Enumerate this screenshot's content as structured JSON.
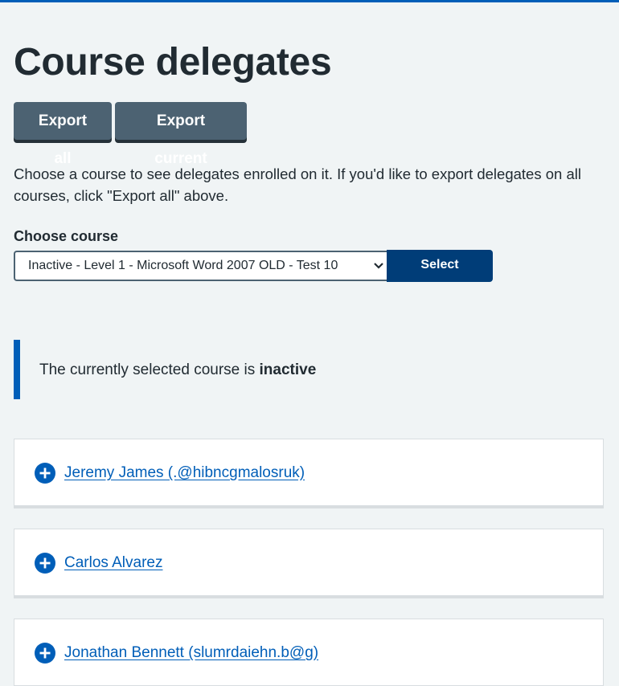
{
  "page": {
    "title": "Course delegates",
    "intro": "Choose a course to see delegates enrolled on it. If you'd like to export delegates on all courses, click \"Export all\" above."
  },
  "toolbar": {
    "export_all_label": "Export all",
    "export_current_label": "Export current"
  },
  "course_picker": {
    "label": "Choose course",
    "selected_value": "Inactive - Level 1 - Microsoft Word 2007 OLD - Test 10",
    "select_button_label": "Select"
  },
  "status_inset": {
    "text_prefix": "The currently selected course is ",
    "status_word": "inactive"
  },
  "delegates": [
    {
      "name": "Jeremy James (.@hibncgmalosruk)"
    },
    {
      "name": "Carlos Alvarez"
    },
    {
      "name": "Jonathan Bennett (slumrdaiehn.b@g)"
    }
  ],
  "icons": {
    "expand": "plus-circle-icon",
    "dropdown": "chevron-down-icon"
  },
  "colors": {
    "accent": "#005eb8",
    "button": "#4c6272",
    "select_button": "#003d78",
    "background": "#f0f4f5"
  }
}
